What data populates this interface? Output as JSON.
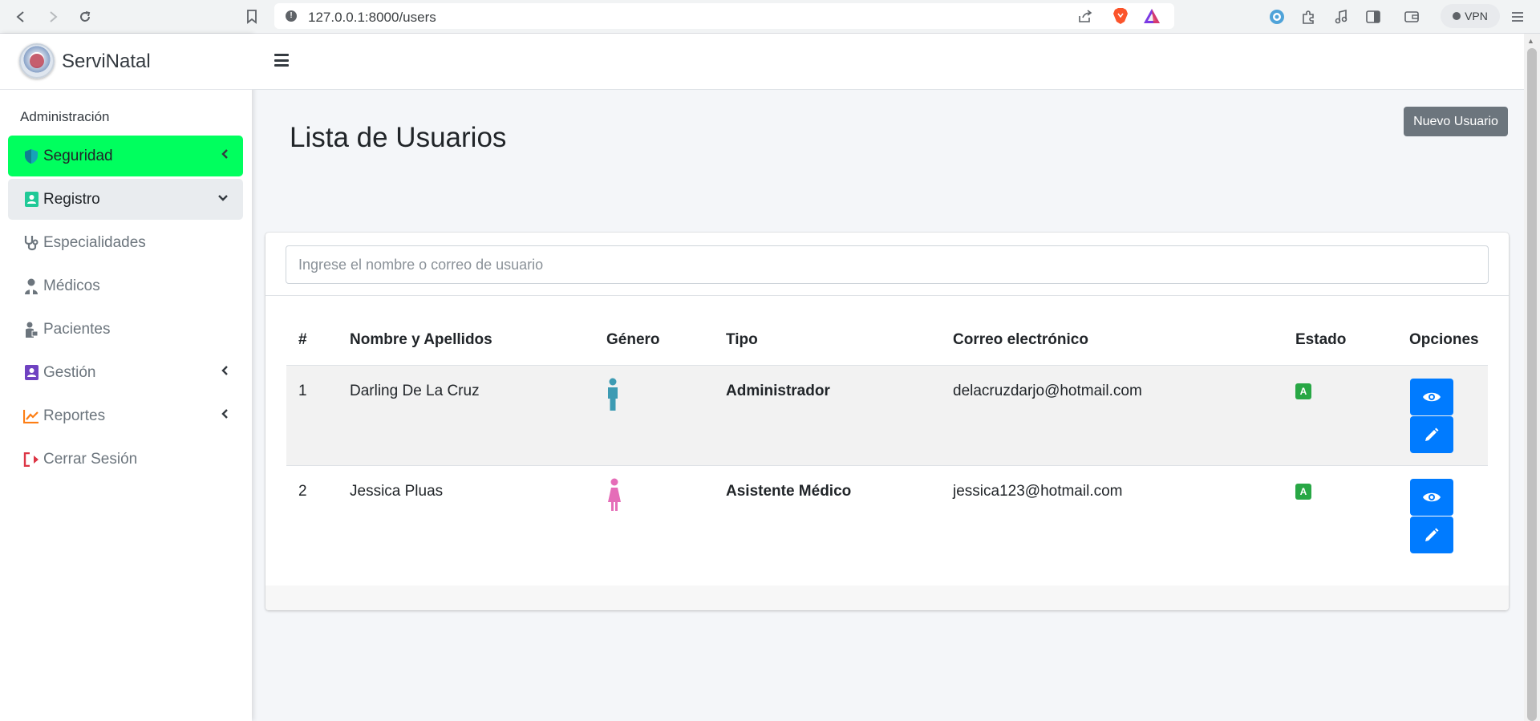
{
  "browser": {
    "url": "127.0.0.1:8000/users",
    "vpn_label": "VPN"
  },
  "brand": {
    "name": "ServiNatal"
  },
  "sidebar": {
    "section_header": "Administración",
    "items": [
      {
        "label": "Seguridad",
        "icon": "shield-icon",
        "state": "active",
        "chevron": "left"
      },
      {
        "label": "Registro",
        "icon": "id-card-icon",
        "state": "open",
        "chevron": "down"
      },
      {
        "label": "Especialidades",
        "icon": "stethoscope-icon",
        "state": "normal"
      },
      {
        "label": "Médicos",
        "icon": "doctor-icon",
        "state": "normal"
      },
      {
        "label": "Pacientes",
        "icon": "patient-icon",
        "state": "normal"
      },
      {
        "label": "Gestión",
        "icon": "contact-card-icon",
        "state": "normal",
        "chevron": "left"
      },
      {
        "label": "Reportes",
        "icon": "chart-line-icon",
        "state": "normal",
        "chevron": "left"
      },
      {
        "label": "Cerrar Sesión",
        "icon": "sign-out-icon",
        "state": "normal"
      }
    ],
    "colors": {
      "active_bg": "#00ff5e",
      "shield": "#17a2b8",
      "registro": "#20c997",
      "gestion": "#6f42c1",
      "reportes": "#fd7e14",
      "logout": "#dc3545"
    }
  },
  "page": {
    "title": "Lista de Usuarios",
    "new_user_label": "Nuevo Usuario"
  },
  "search": {
    "placeholder": "Ingrese el nombre o correo de usuario",
    "value": ""
  },
  "table": {
    "headers": [
      "#",
      "Nombre y Apellidos",
      "Género",
      "Tipo",
      "Correo electrónico",
      "Estado",
      "Opciones"
    ],
    "rows": [
      {
        "num": "1",
        "name": "Darling De La Cruz",
        "gender": "male",
        "type": "Administrador",
        "email": "delacruzdarjo@hotmail.com",
        "status": "A"
      },
      {
        "num": "2",
        "name": "Jessica Pluas",
        "gender": "female",
        "type": "Asistente Médico",
        "email": "jessica123@hotmail.com",
        "status": "A"
      }
    ],
    "colors": {
      "male": "#3d9bb3",
      "female": "#e56db8",
      "status": "#28a745",
      "action": "#007bff"
    }
  }
}
